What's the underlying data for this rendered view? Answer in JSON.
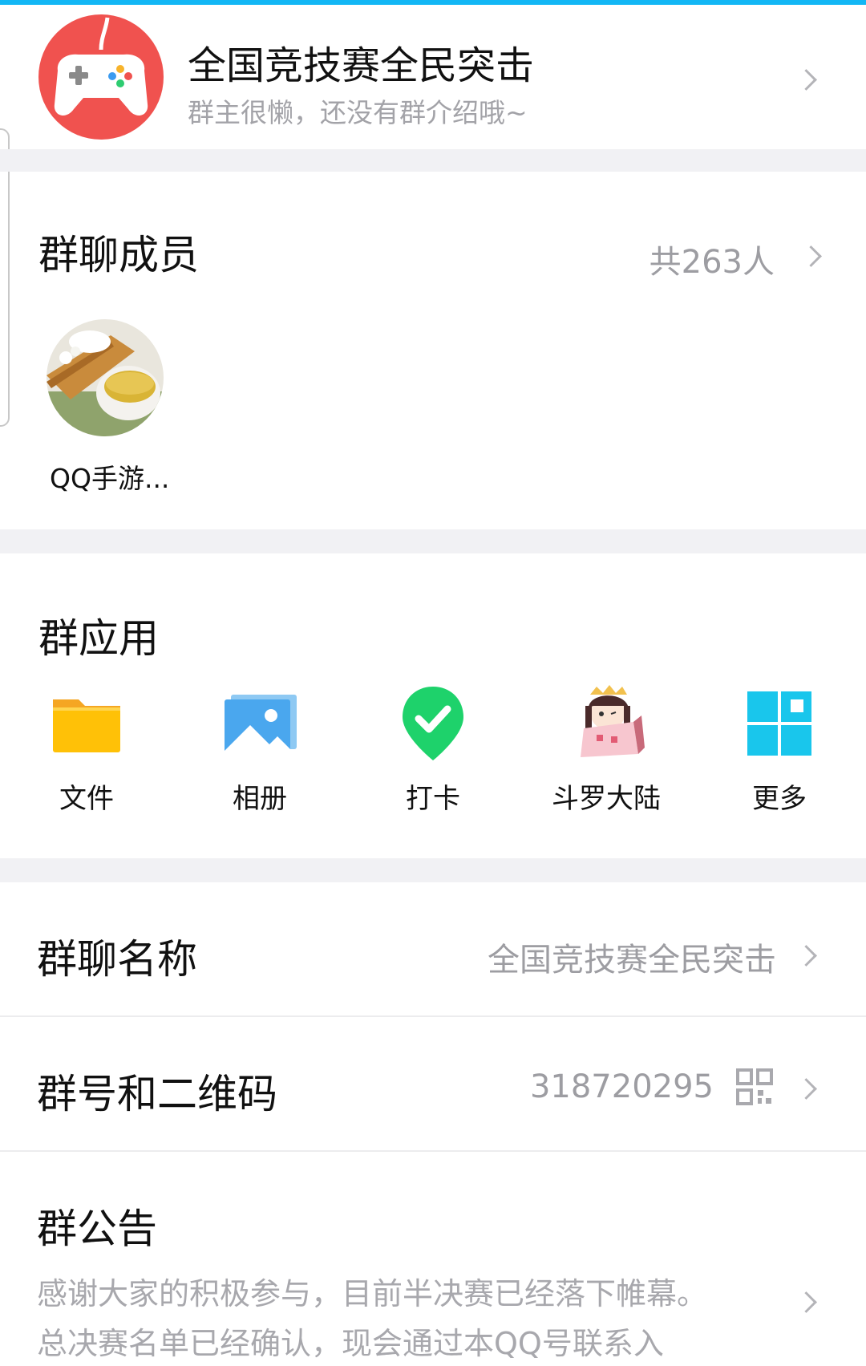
{
  "header": {
    "title": "全国竞技赛全民突击",
    "description": "群主很懒，还没有群介绍哦~",
    "avatar_icon": "game-controller-icon"
  },
  "members": {
    "title": "群聊成员",
    "count_label": "共263人",
    "list": [
      {
        "name": "QQ手游..."
      }
    ]
  },
  "apps": {
    "title": "群应用",
    "items": [
      {
        "label": "文件",
        "icon": "folder-icon"
      },
      {
        "label": "相册",
        "icon": "photo-album-icon"
      },
      {
        "label": "打卡",
        "icon": "checkin-pin-icon"
      },
      {
        "label": "斗罗大陆",
        "icon": "douluo-dalu-icon"
      },
      {
        "label": "更多",
        "icon": "grid-more-icon"
      }
    ]
  },
  "settings": {
    "group_name": {
      "label": "群聊名称",
      "value": "全国竞技赛全民突击"
    },
    "group_number": {
      "label": "群号和二维码",
      "value": "318720295",
      "icon": "qr-code-icon"
    },
    "announcement": {
      "label": "群公告",
      "lines": [
        "感谢大家的积极参与，目前半决赛已经落下帷幕。",
        "总决赛名单已经确认，现会通过本QQ号联系入"
      ]
    }
  },
  "colors": {
    "accent": "#12b7f5",
    "avatar_red": "#f0524f",
    "folder_yellow": "#ffc107",
    "checkin_green": "#1ed26b",
    "more_cyan": "#19c6ec",
    "secondary_text": "#a3a3a8",
    "section_gap": "#f1f1f4"
  }
}
